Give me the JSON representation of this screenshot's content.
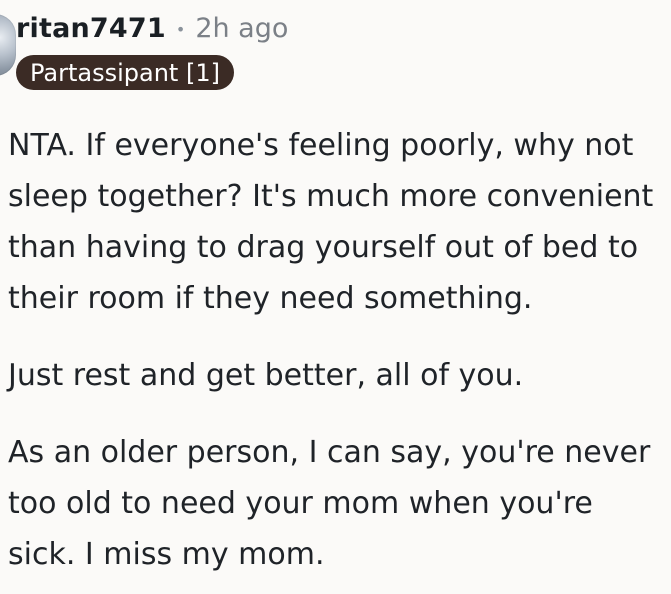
{
  "comment": {
    "username": "ritan7471",
    "separator": "•",
    "timestamp": "2h ago",
    "flair": "Partassipant [1]",
    "paragraphs": [
      "NTA. If everyone's feeling poorly, why not\nsleep together? It's much more convenient\nthan having to drag yourself out of bed to\ntheir room if they need something.",
      "Just rest and get better, all of you.",
      "As an older person, I can say, you're never\ntoo old to need your mom when you're\nsick. I miss my mom."
    ]
  }
}
